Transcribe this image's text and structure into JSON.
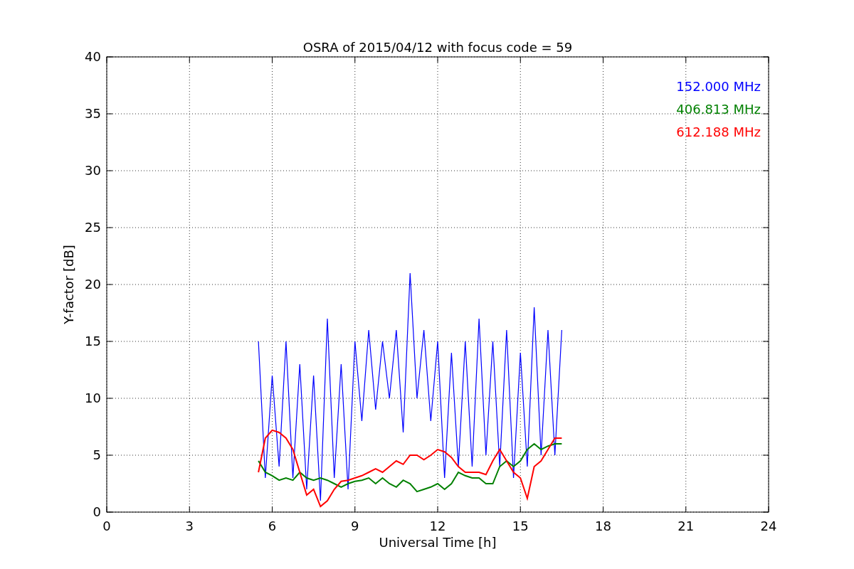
{
  "figure": {
    "chart_data": {
      "type": "line",
      "title": "OSRA of 2015/04/12 with focus code = 59",
      "xlabel": "Universal Time [h]",
      "ylabel": "Y-factor [dB]",
      "x": [
        5.5,
        5.75,
        6,
        6.25,
        6.5,
        6.75,
        7,
        7.25,
        7.5,
        7.75,
        8,
        8.25,
        8.5,
        8.75,
        9,
        9.25,
        9.5,
        9.75,
        10,
        10.25,
        10.5,
        10.75,
        11,
        11.25,
        11.5,
        11.75,
        12,
        12.25,
        12.5,
        12.75,
        13,
        13.25,
        13.5,
        13.75,
        14,
        14.25,
        14.5,
        14.75,
        15,
        15.25,
        15.5,
        15.75,
        16,
        16.25,
        16.5
      ],
      "series": [
        {
          "name": "152.000 MHz",
          "color": "#0000ff",
          "values": [
            15,
            3,
            12,
            4,
            15,
            3,
            13,
            2,
            12,
            1,
            17,
            3,
            13,
            2,
            15,
            8,
            16,
            9,
            15,
            10,
            16,
            7,
            21,
            10,
            16,
            8,
            15,
            3,
            14,
            4,
            15,
            4,
            17,
            5,
            15,
            4,
            16,
            3,
            14,
            4,
            18,
            5,
            16,
            5,
            16
          ]
        },
        {
          "name": "406.813 MHz",
          "color": "#008000",
          "values": [
            4.5,
            3.5,
            3.2,
            2.8,
            3,
            2.8,
            3.5,
            3,
            2.8,
            3,
            2.8,
            2.5,
            2.2,
            2.5,
            2.7,
            2.8,
            3,
            2.5,
            3,
            2.5,
            2.2,
            2.8,
            2.5,
            1.8,
            2,
            2.2,
            2.5,
            2,
            2.5,
            3.5,
            3.2,
            3,
            3,
            2.5,
            2.5,
            4,
            4.5,
            4,
            4.5,
            5.5,
            6,
            5.5,
            5.8,
            6,
            6
          ]
        },
        {
          "name": "612.188 MHz",
          "color": "#ff0000",
          "values": [
            3.5,
            6.5,
            7.2,
            7,
            6.5,
            5.5,
            3.5,
            1.5,
            2,
            0.5,
            1,
            2,
            2.7,
            2.8,
            3,
            3.2,
            3.5,
            3.8,
            3.5,
            4,
            4.5,
            4.2,
            5,
            5,
            4.6,
            5,
            5.5,
            5.3,
            4.8,
            4,
            3.5,
            3.5,
            3.5,
            3.3,
            4.5,
            5.5,
            4.5,
            3.5,
            3,
            1.2,
            4,
            4.5,
            5.5,
            6.5,
            6.5
          ]
        }
      ],
      "xlim": [
        0,
        24
      ],
      "ylim": [
        0,
        40
      ],
      "xticks": [
        0,
        3,
        6,
        9,
        12,
        15,
        18,
        21,
        24
      ],
      "yticks": [
        0,
        5,
        10,
        15,
        20,
        25,
        30,
        35,
        40
      ],
      "grid": true
    }
  }
}
